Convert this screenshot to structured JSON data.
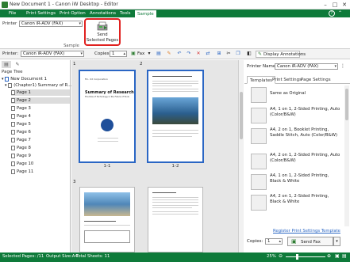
{
  "window": {
    "title": "New Document 1 - Canon iW Desktop - Editor",
    "minimize": "–",
    "maximize": "□",
    "close": "✕"
  },
  "menu": [
    "File",
    "Print Settings",
    "Print Option",
    "Annotations",
    "Tools",
    "Sample"
  ],
  "menu_active": "Sample",
  "ribbon": {
    "printer_label": "Printer",
    "printer_value": "Canon iR-ADV (FAX)",
    "send_line1": "Send",
    "send_line2": "Selected Pages",
    "group_label": "Sample"
  },
  "toolbar": {
    "printer_label": "Printer:",
    "printer_value": "Canon iR-ADV (FAX)",
    "copies_label": "Copies:",
    "copies_value": "1",
    "fax_label": "Fax",
    "display_annotations": "Display Annotations"
  },
  "left": {
    "title": "Page Tree",
    "doc": "New Document 1",
    "chapter": "(Chapter1) Summary of R...",
    "pages": [
      "Page 1",
      "Page 2",
      "Page 3",
      "Page 4",
      "Page 5",
      "Page 6",
      "Page 7",
      "Page 8",
      "Page 9",
      "Page 10",
      "Page 11"
    ]
  },
  "thumbs": {
    "n1": "1",
    "n2": "2",
    "n3": "3",
    "cap1": "1-1",
    "cap2": "1-2",
    "p1_title": "Summary of Research",
    "p1_sub": "The Role of Technology in the Future of Tools",
    "p1_header": "Fin. XX Corporation"
  },
  "right": {
    "printer_label": "Printer Name:",
    "printer_value": "Canon iR-ADV (FAX)",
    "tabs": [
      "Templates",
      "Print Settings",
      "Page Settings"
    ],
    "templates": [
      "Same as Original",
      "A4, 1 on 1, 2-Sided Printing, Auto (Color/B&W)",
      "A4, 2 on 1, Booklet Printing, Saddle Stitch, Auto (Color/B&W)",
      "A4, 2 on 1, 2-Sided Printing, Auto (Color/B&W)",
      "A4, 1 on 1, 2-Sided Printing, Black & White",
      "A4, 2 on 1, 2-Sided Printing, Black & White"
    ],
    "register_link": "Register Print Settings Template",
    "copies_label": "Copies:",
    "copies_value": "1",
    "send_fax": "Send Fax"
  },
  "status": {
    "selected": "Selected Pages: /11",
    "output_size": "Output Size:A4",
    "total": "Total Sheets: 11",
    "zoom": "25%"
  }
}
